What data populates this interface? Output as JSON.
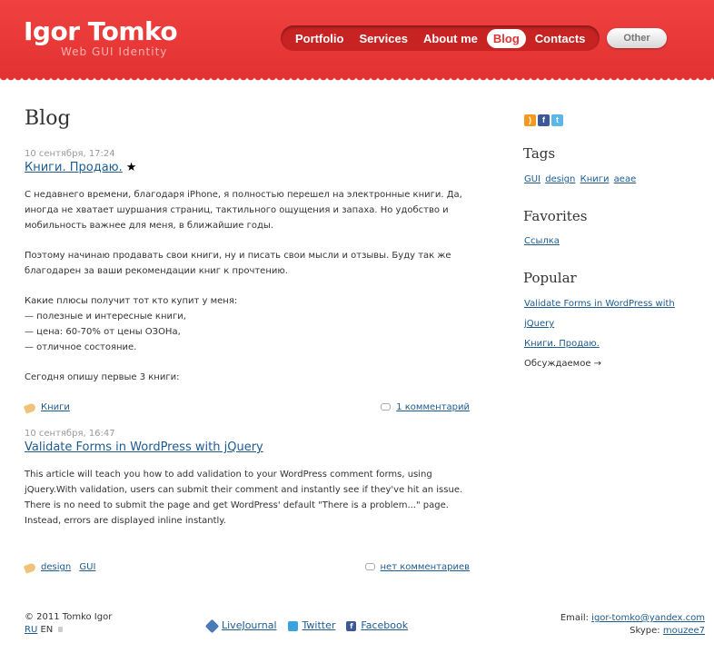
{
  "header": {
    "logo_title": "Igor Tomko",
    "logo_subtitle": "Web  GUI  Identity",
    "nav": [
      "Portfolio",
      "Services",
      "About me",
      "Blog",
      "Contacts"
    ],
    "active_nav": "Blog",
    "other_label": "Other"
  },
  "main": {
    "page_title": "Blog",
    "posts": [
      {
        "date": "10 сентября, 17:24",
        "title": "Книги. Продаю.",
        "star": "★",
        "paragraphs": [
          "С недавнего времени, благодаря iPhone, я полностью перешел на электронные книги. Да, иногда не хватает шуршания страниц, тактильного ощущения и запаха. Но удобство и мобильность важнее для меня, в ближайшие годы.",
          "Поэтому начинаю продавать свои книги, ну и писать свои мысли и отзывы. Буду так же благодарен за ваши рекомендации книг к прочтению.",
          "Какие плюсы получит тот кто купит у меня:\n— полезные и интересные книги,\n— цена: 60-70% от цены ОЗОНа,\n— отличное состояние.",
          "Сегодня опишу первые 3 книги:"
        ],
        "tags": [
          "Книги"
        ],
        "comments": "1 комментарий"
      },
      {
        "date": "10 сентября, 16:47",
        "title": "Validate Forms in WordPress with jQuery",
        "paragraphs": [
          "This article will teach you how to add validation to your WordPress comment forms, using jQuery.With validation, users can submit their comment and instantly see if they've hit an issue. There is no need to submit the page and get WordPress' default \"There is a problem...\" page. Instead, errors are displayed inline instantly."
        ],
        "tags": [
          "design",
          "GUI"
        ],
        "comments": "нет комментариев"
      }
    ]
  },
  "sidebar": {
    "social": [
      "rss-icon",
      "facebook-icon",
      "twitter-icon"
    ],
    "tags_heading": "Tags",
    "tags": [
      "GUI",
      "design",
      "Книги",
      "аеае"
    ],
    "favorites_heading": "Favorites",
    "favorites": [
      "Ссылка"
    ],
    "popular_heading": "Popular",
    "popular": [
      "Validate Forms in WordPress with",
      "jQuery",
      "Книги. Продаю."
    ],
    "discussed": "Обсуждаемое →"
  },
  "footer": {
    "copyright": "© 2011 Tomko Igor",
    "lang_ru": "RU",
    "lang_en": "EN",
    "links": [
      "LiveJournal",
      "Twitter",
      "Facebook"
    ],
    "email_label": "Email:",
    "email": "igor-tomko@yandex.com",
    "skype_label": "Skype:",
    "skype": "mouzee7"
  },
  "colors": {
    "brand_red": "#e23232",
    "link": "#1d5b8f"
  }
}
